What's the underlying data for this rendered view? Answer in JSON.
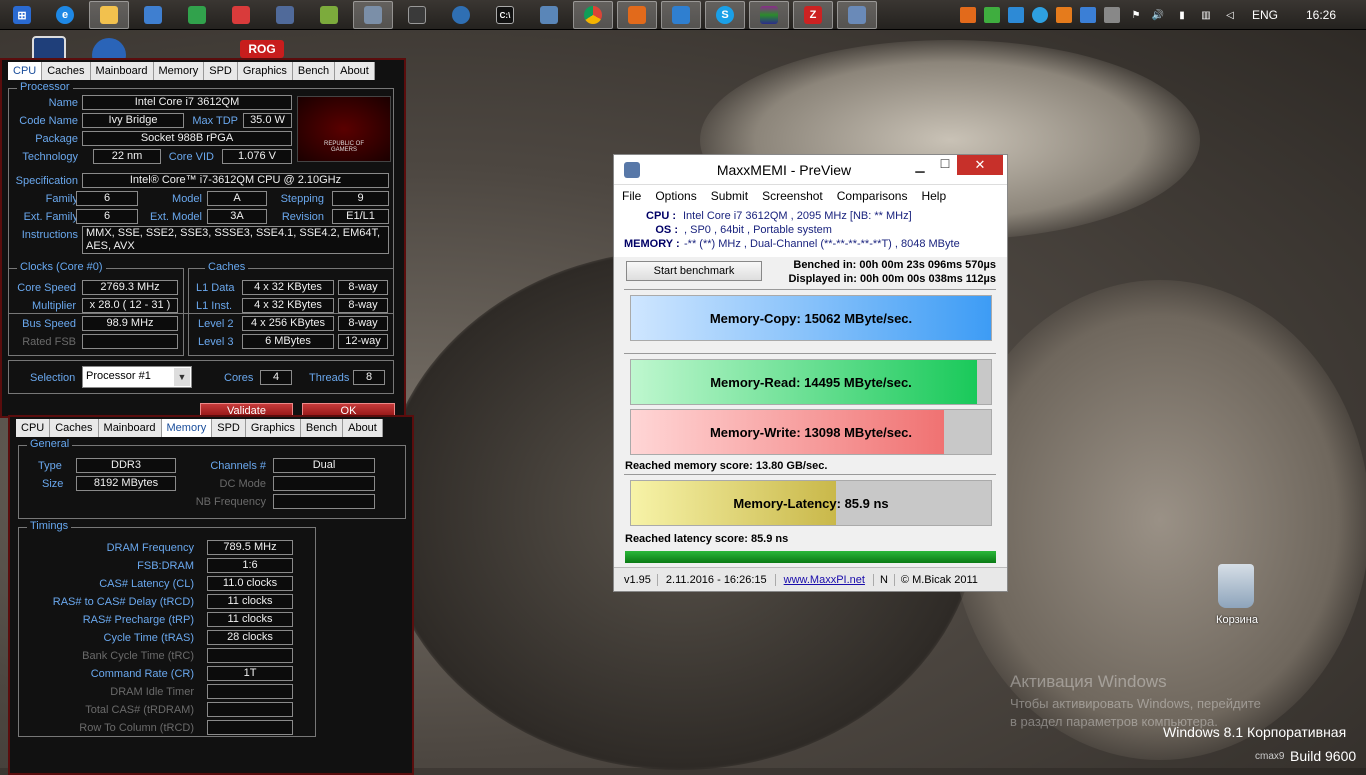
{
  "taskbar": {
    "language": "ENG",
    "time": "16:26"
  },
  "desktop": {
    "recycle_label": "Корзина",
    "watermark1": "Активация Windows",
    "watermark2": "Чтобы активировать Windows, перейдите",
    "watermark3": "в раздел параметров компьютера.",
    "edition": "Windows 8.1 Корпоративная",
    "build": "Build 9600",
    "user": "cmax9"
  },
  "cpuz1": {
    "tabs": [
      "CPU",
      "Caches",
      "Mainboard",
      "Memory",
      "SPD",
      "Graphics",
      "Bench",
      "About"
    ],
    "processor_title": "Processor",
    "name_label": "Name",
    "name": "Intel Core i7 3612QM",
    "codename_label": "Code Name",
    "codename": "Ivy Bridge",
    "maxtdp_label": "Max TDP",
    "maxtdp": "35.0 W",
    "package_label": "Package",
    "package": "Socket 988B rPGA",
    "tech_label": "Technology",
    "tech": "22 nm",
    "corevid_label": "Core VID",
    "corevid": "1.076 V",
    "spec_label": "Specification",
    "spec": "Intel® Core™ i7-3612QM CPU @ 2.10GHz",
    "family_label": "Family",
    "family": "6",
    "model_label": "Model",
    "model": "A",
    "stepping_label": "Stepping",
    "stepping": "9",
    "extfamily_label": "Ext. Family",
    "extfamily": "6",
    "extmodel_label": "Ext. Model",
    "extmodel": "3A",
    "revision_label": "Revision",
    "revision": "E1/L1",
    "instr_label": "Instructions",
    "instr": "MMX, SSE, SSE2, SSE3, SSSE3, SSE4.1, SSE4.2, EM64T, AES, AVX",
    "clocks_title": "Clocks (Core #0)",
    "corespeed_label": "Core Speed",
    "corespeed": "2769.3 MHz",
    "multiplier_label": "Multiplier",
    "multiplier": "x 28.0 ( 12 - 31 )",
    "busspeed_label": "Bus Speed",
    "busspeed": "98.9 MHz",
    "ratedfsb_label": "Rated FSB",
    "caches_title": "Caches",
    "l1d_label": "L1 Data",
    "l1d": "4 x 32 KBytes",
    "l1d_way": "8-way",
    "l1i_label": "L1 Inst.",
    "l1i": "4 x 32 KBytes",
    "l1i_way": "8-way",
    "l2_label": "Level 2",
    "l2": "4 x 256 KBytes",
    "l2_way": "8-way",
    "l3_label": "Level 3",
    "l3": "6 MBytes",
    "l3_way": "12-way",
    "selection_label": "Selection",
    "selection": "Processor #1",
    "cores_label": "Cores",
    "cores": "4",
    "threads_label": "Threads",
    "threads": "8",
    "validate": "Validate",
    "ok": "OK",
    "logo_line1": "REPUBLIC OF",
    "logo_line2": "GAMERS"
  },
  "cpuz2": {
    "tabs": [
      "CPU",
      "Caches",
      "Mainboard",
      "Memory",
      "SPD",
      "Graphics",
      "Bench",
      "About"
    ],
    "general_title": "General",
    "type_label": "Type",
    "type": "DDR3",
    "size_label": "Size",
    "size": "8192 MBytes",
    "channels_label": "Channels #",
    "channels": "Dual",
    "dcmode_label": "DC Mode",
    "nbfreq_label": "NB Frequency",
    "timings_title": "Timings",
    "timings": [
      {
        "label": "DRAM Frequency",
        "value": "789.5 MHz",
        "dim": false
      },
      {
        "label": "FSB:DRAM",
        "value": "1:6",
        "dim": false
      },
      {
        "label": "CAS# Latency (CL)",
        "value": "11.0 clocks",
        "dim": false
      },
      {
        "label": "RAS# to CAS# Delay (tRCD)",
        "value": "11 clocks",
        "dim": false
      },
      {
        "label": "RAS# Precharge (tRP)",
        "value": "11 clocks",
        "dim": false
      },
      {
        "label": "Cycle Time (tRAS)",
        "value": "28 clocks",
        "dim": false
      },
      {
        "label": "Bank Cycle Time (tRC)",
        "value": "",
        "dim": true
      },
      {
        "label": "Command Rate (CR)",
        "value": "1T",
        "dim": false
      },
      {
        "label": "DRAM Idle Timer",
        "value": "",
        "dim": true
      },
      {
        "label": "Total CAS# (tRDRAM)",
        "value": "",
        "dim": true
      },
      {
        "label": "Row To Column (tRCD)",
        "value": "",
        "dim": true
      }
    ]
  },
  "maxxmem": {
    "title": "MaxxMEMI - PreView",
    "menu": [
      "File",
      "Options",
      "Submit",
      "Screenshot",
      "Comparisons",
      "Help"
    ],
    "cpu_label": "CPU :",
    "cpu": "Intel Core i7 3612QM , 2095 MHz  [NB: ** MHz]",
    "os_label": "OS :",
    "os": ", SP0 , 64bit , Portable system",
    "mem_label": "MEMORY :",
    "mem": "-** (**) MHz , Dual-Channel (**-**-**-**-**T) , 8048 MByte",
    "start_btn": "Start benchmark",
    "benched": "Benched in: 00h 00m 23s 096ms 570µs",
    "displayed": "Displayed in: 00h 00m 00s 038ms 112µs",
    "copy": "Memory-Copy: 15062 MByte/sec.",
    "read": "Memory-Read: 14495 MByte/sec.",
    "write": "Memory-Write: 13098 MByte/sec.",
    "mem_score": "Reached memory score: 13.80 GB/sec.",
    "latency": "Memory-Latency: 85.9 ns",
    "lat_score": "Reached latency score: 85.9 ns",
    "version": "v1.95",
    "date": "2.11.2016 - 16:26:15",
    "url": "www.MaxxPI.net",
    "n": "N",
    "copyright": "© M.Bicak 2011",
    "fills": {
      "copy": 1.0,
      "read": 0.96,
      "write": 0.87,
      "latency": 0.57
    },
    "colors": {
      "copy": "#3d9cf5",
      "read": "#19c95a",
      "write": "#f07272",
      "latency": "#c9b84a"
    }
  }
}
